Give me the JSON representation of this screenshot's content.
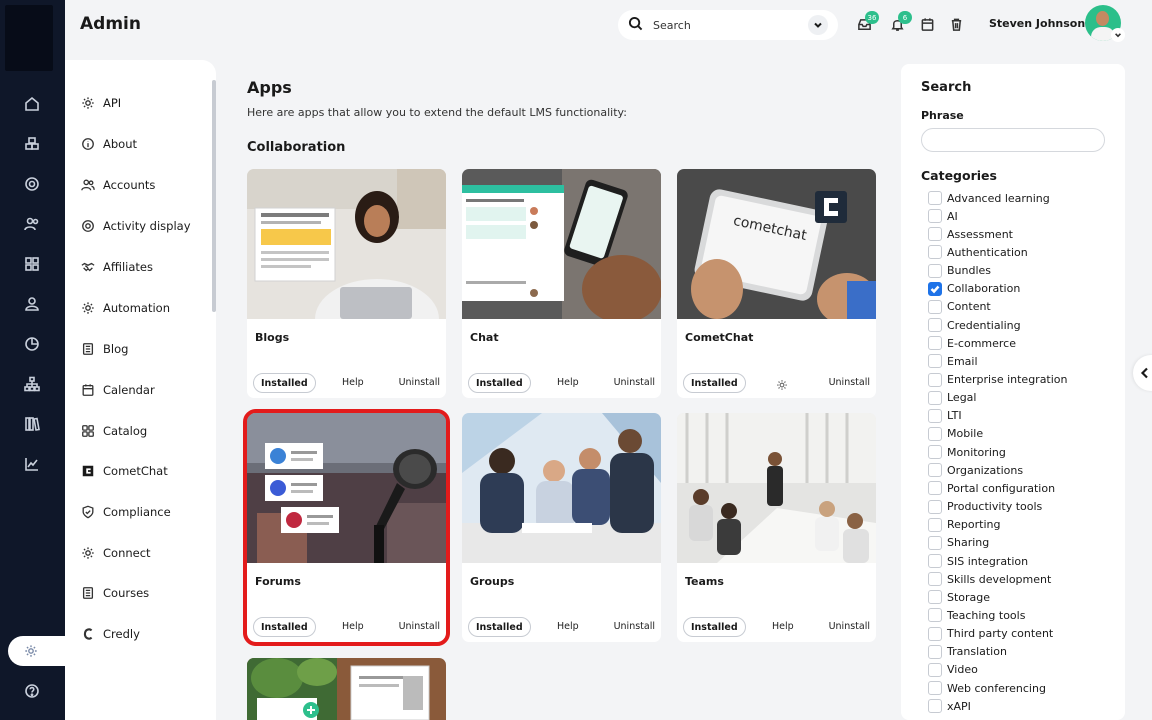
{
  "header": {
    "title": "Admin",
    "search_label": "Search",
    "messages_badge": "36",
    "notifications_badge": "6",
    "user_name": "Steven Johnson"
  },
  "submenu": {
    "items": [
      {
        "label": "API",
        "icon": "gear-icon"
      },
      {
        "label": "About",
        "icon": "info-icon"
      },
      {
        "label": "Accounts",
        "icon": "users-icon"
      },
      {
        "label": "Activity display",
        "icon": "target-icon"
      },
      {
        "label": "Affiliates",
        "icon": "handshake-icon"
      },
      {
        "label": "Automation",
        "icon": "gear-icon"
      },
      {
        "label": "Blog",
        "icon": "document-icon"
      },
      {
        "label": "Calendar",
        "icon": "calendar-icon"
      },
      {
        "label": "Catalog",
        "icon": "grid-icon"
      },
      {
        "label": "CometChat",
        "icon": "cometchat-icon"
      },
      {
        "label": "Compliance",
        "icon": "shield-icon"
      },
      {
        "label": "Connect",
        "icon": "gear-icon"
      },
      {
        "label": "Courses",
        "icon": "document-icon"
      },
      {
        "label": "Credly",
        "icon": "credly-icon"
      }
    ]
  },
  "main": {
    "title": "Apps",
    "description": "Here are apps that allow you to extend the default LMS functionality:",
    "section": "Collaboration",
    "cards": [
      {
        "name": "Blogs",
        "installed": "Installed",
        "help": "Help",
        "uninstall": "Uninstall"
      },
      {
        "name": "Chat",
        "installed": "Installed",
        "help": "Help",
        "uninstall": "Uninstall"
      },
      {
        "name": "CometChat",
        "installed": "Installed",
        "help": "",
        "uninstall": "Uninstall"
      },
      {
        "name": "Forums",
        "installed": "Installed",
        "help": "Help",
        "uninstall": "Uninstall"
      },
      {
        "name": "Groups",
        "installed": "Installed",
        "help": "Help",
        "uninstall": "Uninstall"
      },
      {
        "name": "Teams",
        "installed": "Installed",
        "help": "Help",
        "uninstall": "Uninstall"
      }
    ]
  },
  "filters": {
    "search_title": "Search",
    "phrase_label": "Phrase",
    "phrase_value": "",
    "categories_title": "Categories",
    "categories": [
      {
        "label": "Advanced learning",
        "checked": false
      },
      {
        "label": "AI",
        "checked": false
      },
      {
        "label": "Assessment",
        "checked": false
      },
      {
        "label": "Authentication",
        "checked": false
      },
      {
        "label": "Bundles",
        "checked": false
      },
      {
        "label": "Collaboration",
        "checked": true
      },
      {
        "label": "Content",
        "checked": false
      },
      {
        "label": "Credentialing",
        "checked": false
      },
      {
        "label": "E-commerce",
        "checked": false
      },
      {
        "label": "Email",
        "checked": false
      },
      {
        "label": "Enterprise integration",
        "checked": false
      },
      {
        "label": "Legal",
        "checked": false
      },
      {
        "label": "LTI",
        "checked": false
      },
      {
        "label": "Mobile",
        "checked": false
      },
      {
        "label": "Monitoring",
        "checked": false
      },
      {
        "label": "Organizations",
        "checked": false
      },
      {
        "label": "Portal configuration",
        "checked": false
      },
      {
        "label": "Productivity tools",
        "checked": false
      },
      {
        "label": "Reporting",
        "checked": false
      },
      {
        "label": "Sharing",
        "checked": false
      },
      {
        "label": "SIS integration",
        "checked": false
      },
      {
        "label": "Skills development",
        "checked": false
      },
      {
        "label": "Storage",
        "checked": false
      },
      {
        "label": "Teaching tools",
        "checked": false
      },
      {
        "label": "Third party content",
        "checked": false
      },
      {
        "label": "Translation",
        "checked": false
      },
      {
        "label": "Video",
        "checked": false
      },
      {
        "label": "Web conferencing",
        "checked": false
      },
      {
        "label": "xAPI",
        "checked": false
      }
    ]
  },
  "colors": {
    "rail": "#0f1729",
    "accent": "#2dbf8c",
    "selection": "#e31b1b",
    "checkbox": "#1e73e8"
  }
}
